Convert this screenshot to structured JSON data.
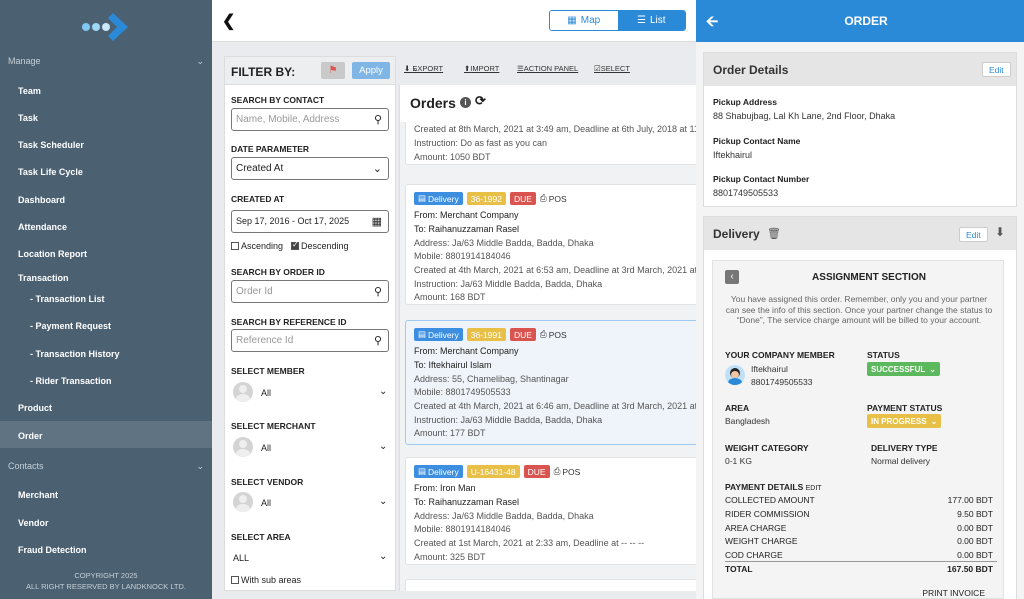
{
  "sidebar": {
    "manage_label": "Manage",
    "contacts_label": "Contacts",
    "manage_items": [
      {
        "label": "Team"
      },
      {
        "label": "Task"
      },
      {
        "label": "Task Scheduler"
      },
      {
        "label": "Task Life Cycle"
      },
      {
        "label": "Dashboard"
      },
      {
        "label": "Attendance"
      },
      {
        "label": "Location Report"
      },
      {
        "label": "Transaction"
      },
      {
        "label": "- Transaction List"
      },
      {
        "label": "- Payment Request"
      },
      {
        "label": "- Transaction History"
      },
      {
        "label": "- Rider Transaction"
      },
      {
        "label": "Product"
      },
      {
        "label": "Order"
      }
    ],
    "contacts_items": [
      {
        "label": "Merchant"
      },
      {
        "label": "Vendor"
      },
      {
        "label": "Fraud Detection"
      }
    ],
    "copyright_line1": "COPYRIGHT 2025",
    "copyright_line2": "ALL RIGHT RESERVED BY LANDKNOCK LTD."
  },
  "topbar": {
    "map_label": "Map",
    "list_label": "List"
  },
  "filter": {
    "title": "FILTER BY:",
    "apply_label": "Apply",
    "search_contact_label": "SEARCH BY CONTACT",
    "search_contact_placeholder": "Name, Mobile, Address",
    "date_param_label": "DATE PARAMETER",
    "date_param_value": "Created At",
    "created_at_label": "CREATED AT",
    "created_at_value": "Sep 17, 2016 - Oct 17, 2025",
    "ascending_label": "Ascending",
    "descending_label": "Descending",
    "order_id_label": "SEARCH BY ORDER ID",
    "order_id_placeholder": "Order Id",
    "reference_id_label": "SEARCH BY REFERENCE ID",
    "reference_id_placeholder": "Reference Id",
    "member_label": "SELECT MEMBER",
    "member_value": "All",
    "merchant_label": "SELECT MERCHANT",
    "merchant_value": "All",
    "vendor_label": "SELECT VENDOR",
    "vendor_value": "All",
    "area_label": "SELECT AREA",
    "area_value": "ALL",
    "sub_areas_label": "With sub areas"
  },
  "toolbar": {
    "export_label": "EXPORT",
    "import_label": "IMPORT",
    "action_panel_label": "ACTION PANEL",
    "select_label": "SELECT"
  },
  "orders": {
    "title": "Orders",
    "partial_card": {
      "created": "Created at 8th March, 2021 at 3:49 am, Deadline at 6th July, 2018 at 11",
      "instruction": "Instruction: Do as fast as you can",
      "amount": "Amount: 1050 BDT"
    },
    "cards": [
      {
        "type": "Delivery",
        "id": "36-1992",
        "status": "DUE",
        "channel": "POS",
        "from": "From: Merchant Company",
        "to": "To: Raihanuzzaman Rasel",
        "address": "Address: Ja/63 Middle Badda, Badda, Dhaka",
        "mobile": "Mobile: 8801914184046",
        "created": "Created at 4th March, 2021 at 6:53 am, Deadline at 3rd March, 2021 at",
        "instruction": "Instruction: Ja/63 Middle Badda, Badda, Dhaka",
        "amount": "Amount: 168 BDT"
      },
      {
        "type": "Delivery",
        "id": "36-1991",
        "status": "DUE",
        "channel": "POS",
        "from": "From: Merchant Company",
        "to": "To: Iftekhairul Islam",
        "address": "Address: 55, Chamelibag, Shantinagar",
        "mobile": "Mobile: 8801749505533",
        "created": "Created at 4th March, 2021 at 6:46 am, Deadline at 3rd March, 2021 at",
        "instruction": "Instruction: Ja/63 Middle Badda, Badda, Dhaka",
        "amount": "Amount: 177 BDT"
      },
      {
        "type": "Delivery",
        "id": "U-16431-48",
        "status": "DUE",
        "channel": "POS",
        "from": "From: Iron Man",
        "to": "To: Raihanuzzaman Rasel",
        "address": "Address: Ja/63 Middle Badda, Badda, Dhaka",
        "mobile": "Mobile: 8801914184046",
        "created": "Created at 1st March, 2021 at 2:33 am, Deadline at -- -- --",
        "amount": "Amount: 325 BDT"
      }
    ]
  },
  "right": {
    "title": "ORDER",
    "details_title": "Order Details",
    "edit_label": "Edit",
    "pickup_address_label": "Pickup Address",
    "pickup_address": "88 Shabujbag, Lal Kh Lane, 2nd Floor, Dhaka",
    "pickup_name_label": "Pickup Contact Name",
    "pickup_name": "Iftekhairul",
    "pickup_number_label": "Pickup Contact Number",
    "pickup_number": "8801749505533",
    "delivery_title": "Delivery",
    "assign": {
      "title": "ASSIGNMENT SECTION",
      "note": "You have assigned this order. Remember, only you and your partner can see the info of this section. Once your partner change the status to “Done”, The service charge amount will be billed to your account.",
      "member_label": "YOUR COMPANY MEMBER",
      "member_name": "Iftekhairul",
      "member_phone": "8801749505533",
      "status_label": "STATUS",
      "status_value": "SUCCESSFUL",
      "area_label": "AREA",
      "area_value": "Bangladesh",
      "payment_status_label": "PAYMENT STATUS",
      "payment_status_value": "IN PROGRESS",
      "weight_label": "WEIGHT CATEGORY",
      "weight_value": "0-1 KG",
      "delivery_type_label": "DELIVERY TYPE",
      "delivery_type_value": "Normal delivery",
      "payment_details_label": "PAYMENT DETAILS",
      "payment_edit_label": "EDIT",
      "payments": [
        {
          "label": "COLLECTED AMOUNT",
          "value": "177.00 BDT"
        },
        {
          "label": "RIDER COMMISSION",
          "value": "9.50 BDT"
        },
        {
          "label": "AREA CHARGE",
          "value": "0.00 BDT"
        },
        {
          "label": "WEIGHT CHARGE",
          "value": "0.00 BDT"
        },
        {
          "label": "COD CHARGE",
          "value": "0.00 BDT"
        }
      ],
      "total_label": "TOTAL",
      "total_value": "167.50 BDT",
      "print_label": "PRINT INVOICE"
    }
  },
  "colors": {
    "sidebar": "#4b6071",
    "accent": "#2b8ad8",
    "success": "#5cb85c",
    "warning": "#e8c048",
    "danger": "#d9534f"
  }
}
